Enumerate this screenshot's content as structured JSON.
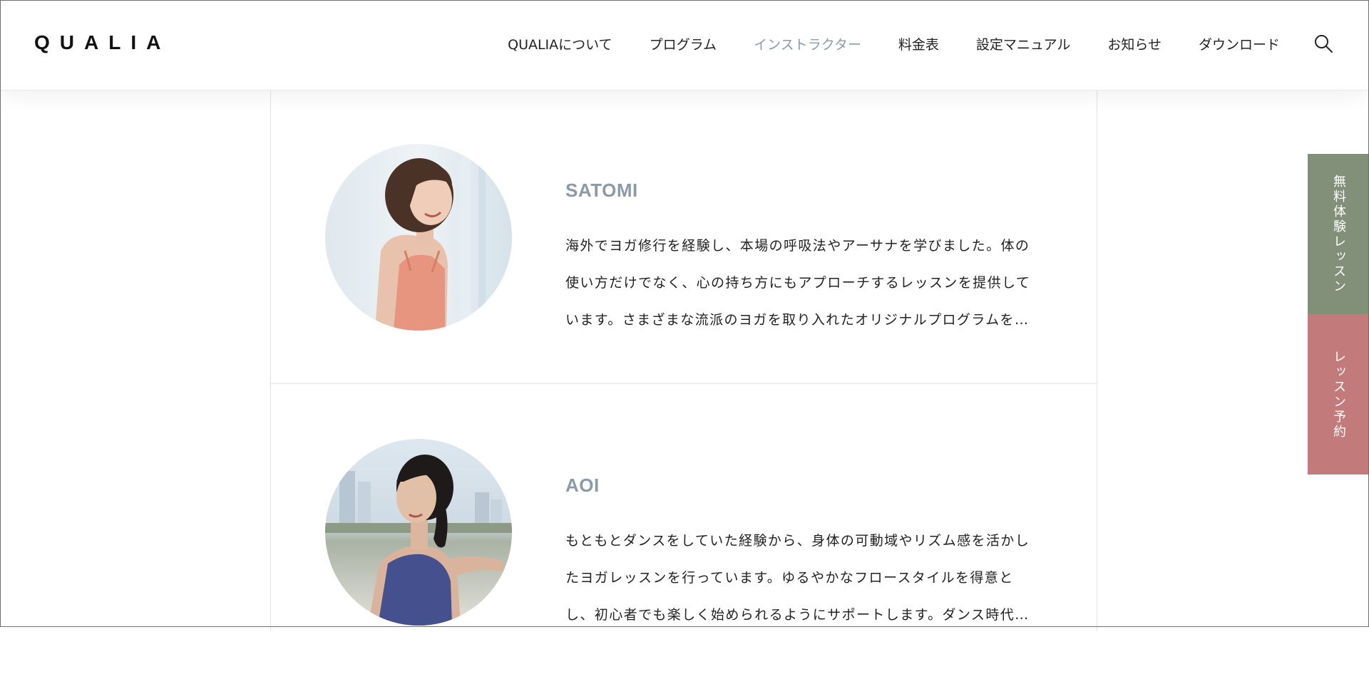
{
  "header": {
    "logo": "QUALIA",
    "nav": [
      {
        "label": "QUALIAについて"
      },
      {
        "label": "プログラム"
      },
      {
        "label": "インストラクター",
        "active": true
      },
      {
        "label": "料金表"
      },
      {
        "label": "設定マニュアル"
      },
      {
        "label": "お知らせ"
      },
      {
        "label": "ダウンロード"
      }
    ],
    "search_icon": "search-icon"
  },
  "instructors": [
    {
      "name": "SATOMI",
      "bio": "海外でヨガ修行を経験し、本場の呼吸法やアーサナを学びました。体の使い方だけでなく、心の持ち方にもアプローチするレッスンを提供しています。さまざまな流派のヨガを取り入れたオリジナルプログラムを展開し…"
    },
    {
      "name": "AOI",
      "bio": "もともとダンスをしていた経験から、身体の可動域やリズム感を活かしたヨガレッスンを行っています。ゆるやかなフロースタイルを得意とし、初心者でも楽しく始められるようにサポートします。ダンス時代に培った…"
    }
  ],
  "side_tabs": {
    "trial": "無料体験レッスン",
    "reserve": "レッスン予約"
  },
  "colors": {
    "accent_name": "#8a9aa8",
    "trial_tab": "#829079",
    "reserve_tab": "#c27a7a"
  }
}
